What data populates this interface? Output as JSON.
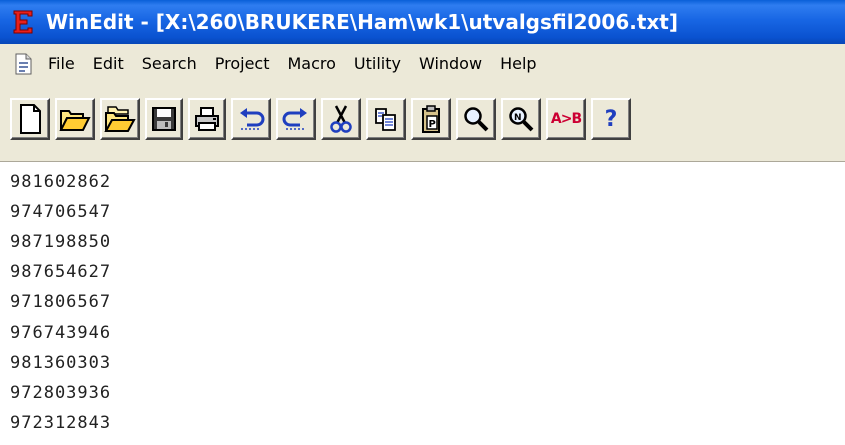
{
  "window": {
    "title": "WinEdit - [X:\\260\\BRUKERE\\Ham\\wk1\\utvalgsfil2006.txt]",
    "app_icon": "winedit-e-icon",
    "accent_color": "#0a52d0"
  },
  "menu": {
    "items": [
      "File",
      "Edit",
      "Search",
      "Project",
      "Macro",
      "Utility",
      "Window",
      "Help"
    ]
  },
  "toolbar": {
    "buttons": [
      {
        "icon": "new-file-icon"
      },
      {
        "icon": "open-folder-icon"
      },
      {
        "icon": "open-project-icon"
      },
      {
        "icon": "save-icon"
      },
      {
        "icon": "print-icon"
      },
      {
        "icon": "undo-icon"
      },
      {
        "icon": "redo-icon"
      },
      {
        "icon": "cut-icon"
      },
      {
        "icon": "copy-icon"
      },
      {
        "icon": "paste-icon"
      },
      {
        "icon": "find-icon"
      },
      {
        "icon": "find-next-icon"
      },
      {
        "icon": "replace-icon",
        "label": "A>B"
      },
      {
        "icon": "help-icon",
        "label": "?"
      }
    ]
  },
  "editor": {
    "lines": [
      "981602862",
      "974706547",
      "987198850",
      "987654627",
      "971806567",
      "976743946",
      "981360303",
      "972803936",
      "972312843"
    ]
  }
}
